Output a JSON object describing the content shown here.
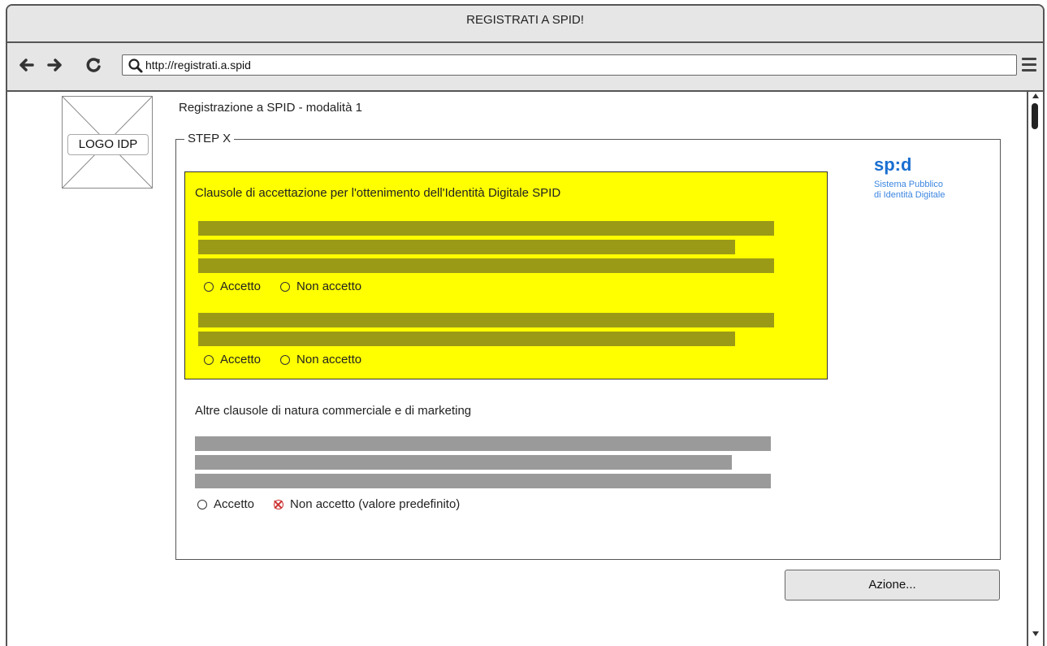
{
  "window": {
    "title": "REGISTRATI A SPID!"
  },
  "toolbar": {
    "url": "http://registrati.a.spid",
    "back_icon": "back-arrow-icon",
    "forward_icon": "forward-arrow-icon",
    "reload_icon": "reload-icon",
    "search_icon": "search-icon",
    "menu_icon": "hamburger-menu-icon"
  },
  "logo": {
    "label": "LOGO IDP"
  },
  "page": {
    "title": "Registrazione a SPID - modalità 1",
    "step_legend": "STEP X"
  },
  "spid_brand": {
    "name": "sp:d",
    "subtitle_line1": "Sistema Pubblico",
    "subtitle_line2": "di Identità Digitale",
    "color": "#1a6fd1"
  },
  "mandatory_section": {
    "title": "Clausole di accettazione per l'ottenimento dell'Identità Digitale SPID",
    "background": "#ffff00",
    "clauses": [
      {
        "accept_label": "Accetto",
        "reject_label": "Non accetto"
      },
      {
        "accept_label": "Accetto",
        "reject_label": "Non accetto"
      }
    ]
  },
  "commercial_section": {
    "title": "Altre clausole di natura commerciale e di marketing",
    "accept_label": "Accetto",
    "reject_label": "Non accetto (valore predefinito)",
    "selected": "reject"
  },
  "action": {
    "label": "Azione..."
  }
}
